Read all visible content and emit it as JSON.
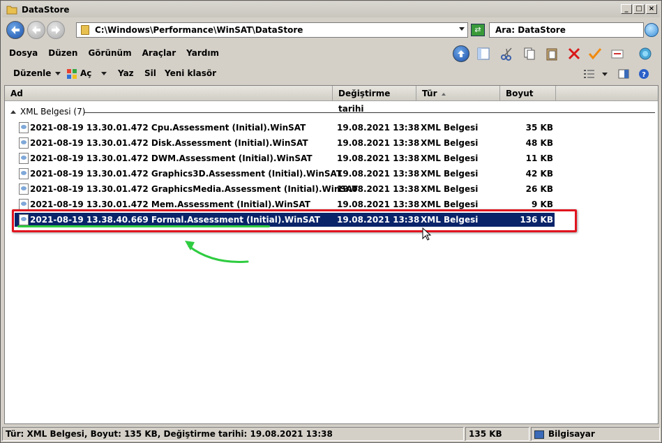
{
  "window": {
    "title": "DataStore"
  },
  "address": {
    "path": "C:\\Windows\\Performance\\WinSAT\\DataStore"
  },
  "search": {
    "placeholder": "Ara: DataStore"
  },
  "menu": [
    "Dosya",
    "Düzen",
    "Görünüm",
    "Araçlar",
    "Yardım"
  ],
  "commands": {
    "organize": "Düzenle",
    "open": "Aç",
    "print": "Yaz",
    "delete": "Sil",
    "new_folder": "Yeni klasör"
  },
  "columns": {
    "name": "Ad",
    "date": "Değiştirme tarihi",
    "type": "Tür",
    "size": "Boyut"
  },
  "group": {
    "label": "XML Belgesi (7)"
  },
  "files": [
    {
      "name": "2021-08-19 13.30.01.472 Cpu.Assessment (Initial).WinSAT",
      "date": "19.08.2021 13:38",
      "type": "XML Belgesi",
      "size": "35 KB"
    },
    {
      "name": "2021-08-19 13.30.01.472 Disk.Assessment (Initial).WinSAT",
      "date": "19.08.2021 13:38",
      "type": "XML Belgesi",
      "size": "48 KB"
    },
    {
      "name": "2021-08-19 13.30.01.472 DWM.Assessment (Initial).WinSAT",
      "date": "19.08.2021 13:38",
      "type": "XML Belgesi",
      "size": "11 KB"
    },
    {
      "name": "2021-08-19 13.30.01.472 Graphics3D.Assessment (Initial).WinSAT",
      "date": "19.08.2021 13:38",
      "type": "XML Belgesi",
      "size": "42 KB"
    },
    {
      "name": "2021-08-19 13.30.01.472 GraphicsMedia.Assessment (Initial).WinSAT",
      "date": "19.08.2021 13:38",
      "type": "XML Belgesi",
      "size": "26 KB"
    },
    {
      "name": "2021-08-19 13.30.01.472 Mem.Assessment (Initial).WinSAT",
      "date": "19.08.2021 13:38",
      "type": "XML Belgesi",
      "size": "9 KB"
    },
    {
      "name": "2021-08-19 13.38.40.669 Formal.Assessment (Initial).WinSAT",
      "date": "19.08.2021 13:38",
      "type": "XML Belgesi",
      "size": "136 KB",
      "selected": true
    }
  ],
  "status": {
    "details": "Tür: XML Belgesi, Boyut: 135 KB, Değiştirme tarihi: 19.08.2021 13:38",
    "size": "135 KB",
    "zone": "Bilgisayar"
  },
  "colors": {
    "selection": "#0a246a",
    "highlight_box": "#e0141e",
    "annotation_arrow": "#2ecc40"
  }
}
